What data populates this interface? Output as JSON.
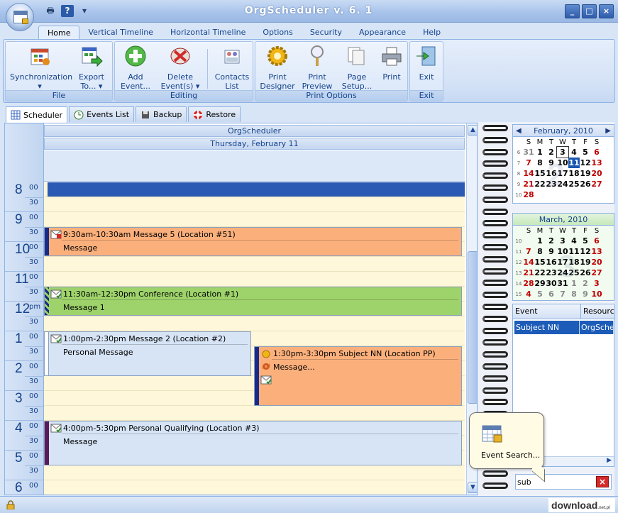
{
  "app": {
    "title": "OrgScheduler v. 6. 1",
    "window_buttons": [
      "_",
      "□",
      "×"
    ]
  },
  "ribbon_tabs": [
    "Home",
    "Vertical Timeline",
    "Horizontal Timeline",
    "Options",
    "Security",
    "Appearance",
    "Help"
  ],
  "ribbon": {
    "groups": {
      "file": "File",
      "editing": "Editing",
      "print_options": "Print Options",
      "exit": "Exit"
    },
    "buttons": {
      "synchronization": "Synchronization",
      "export": "Export",
      "export2": "To...",
      "add_event": "Add",
      "add_event2": "Event...",
      "delete_events": "Delete",
      "delete_events2": "Event(s)",
      "contacts": "Contacts",
      "contacts2": "List",
      "print_designer": "Print",
      "print_designer2": "Designer",
      "print_preview": "Print",
      "print_preview2": "Preview",
      "page_setup": "Page",
      "page_setup2": "Setup...",
      "print": "Print",
      "exit": "Exit"
    }
  },
  "page_tabs": [
    "Scheduler",
    "Events List",
    "Backup",
    "Restore"
  ],
  "scheduler": {
    "resource_header": "OrgScheduler",
    "date_header": "Thursday, February 11",
    "hours": [
      {
        "h": "8",
        "m": "00"
      },
      {
        "h": "9",
        "m": "00"
      },
      {
        "h": "10",
        "m": "00"
      },
      {
        "h": "11",
        "m": "00"
      },
      {
        "h": "12",
        "m": "pm"
      },
      {
        "h": "1",
        "m": "00"
      },
      {
        "h": "2",
        "m": "00"
      },
      {
        "h": "3",
        "m": "00"
      },
      {
        "h": "4",
        "m": "00"
      },
      {
        "h": "5",
        "m": "00"
      },
      {
        "h": "6",
        "m": "00"
      }
    ],
    "half_label": "30",
    "events": [
      {
        "title": "9:30am-10:30am Message 5 (Location #51)",
        "body": "Message",
        "color": "#fbb07c",
        "bar": "#1a2a8a"
      },
      {
        "title": "11:30am-12:30pm Conference (Location #1)",
        "body": "Message 1",
        "color": "#9ed36b",
        "bar": "#1a2a8a"
      },
      {
        "title": "1:00pm-2:30pm Message 2 (Location #2)",
        "body": "Personal Message",
        "color": "#d6e4f6",
        "bar": "#ffffff"
      },
      {
        "title": "1:30pm-3:30pm Subject NN (Location PP)",
        "body": "Message...",
        "color": "#fbb07c",
        "bar": "#1a2a8a"
      },
      {
        "title": "4:00pm-5:30pm Personal Qualifying (Location #3)",
        "body": "Message",
        "color": "#d6e4f6",
        "bar": "#5a1a5a"
      }
    ]
  },
  "mini_calendars": [
    {
      "title": "February, 2010",
      "dow": [
        "S",
        "M",
        "T",
        "W",
        "T",
        "F",
        "S"
      ],
      "weeks": [
        {
          "wk": "6",
          "days": [
            "31",
            "1",
            "2",
            "3",
            "4",
            "5",
            "6"
          ]
        },
        {
          "wk": "7",
          "days": [
            "7",
            "8",
            "9",
            "10",
            "11",
            "12",
            "13"
          ]
        },
        {
          "wk": "8",
          "days": [
            "14",
            "15",
            "16",
            "17",
            "18",
            "19",
            "20"
          ]
        },
        {
          "wk": "9",
          "days": [
            "21",
            "22",
            "23",
            "24",
            "25",
            "26",
            "27"
          ]
        },
        {
          "wk": "10",
          "days": [
            "28",
            "",
            "",
            "",
            "",
            "",
            ""
          ]
        }
      ]
    },
    {
      "title": "March, 2010",
      "dow": [
        "S",
        "M",
        "T",
        "W",
        "T",
        "F",
        "S"
      ],
      "weeks": [
        {
          "wk": "10",
          "days": [
            "",
            "1",
            "2",
            "3",
            "4",
            "5",
            "6"
          ]
        },
        {
          "wk": "11",
          "days": [
            "7",
            "8",
            "9",
            "10",
            "11",
            "12",
            "13"
          ]
        },
        {
          "wk": "12",
          "days": [
            "14",
            "15",
            "16",
            "17",
            "18",
            "19",
            "20"
          ]
        },
        {
          "wk": "13",
          "days": [
            "21",
            "22",
            "23",
            "24",
            "25",
            "26",
            "27"
          ]
        },
        {
          "wk": "14",
          "days": [
            "28",
            "29",
            "30",
            "31",
            "1",
            "2",
            "3"
          ]
        },
        {
          "wk": "15",
          "days": [
            "4",
            "5",
            "6",
            "7",
            "8",
            "9",
            "10"
          ]
        }
      ]
    }
  ],
  "events_grid": {
    "columns": [
      "Event",
      "Resource"
    ],
    "row": [
      "Subject NN",
      "OrgScheduler"
    ]
  },
  "search": {
    "value": "sub",
    "clear": "×"
  },
  "tooltip": {
    "text": "Event Search..."
  },
  "watermark": {
    "text": "download",
    "suffix": ".net.pl"
  },
  "colors": {
    "accent": "#1a56b0",
    "today": "#1a56b0",
    "slot": "#fff7d9"
  }
}
